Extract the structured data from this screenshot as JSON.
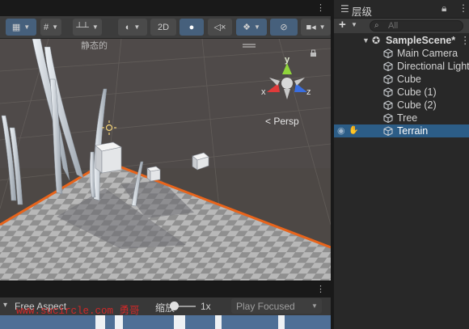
{
  "scene_toolbar": {
    "mode_2d": "2D"
  },
  "scene_view": {
    "overlay_label": "静态的",
    "gizmo": {
      "y": "y",
      "x": "x",
      "z": "z"
    },
    "projection": "< Persp"
  },
  "game_toolbar": {
    "aspect": "Free Aspect",
    "scale_label": "缩放",
    "scale_value": "1x",
    "play_mode": "Play Focused"
  },
  "hierarchy": {
    "tab_title": "层级",
    "search_placeholder": "All",
    "scene_name": "SampleScene*",
    "items": [
      {
        "label": "Main Camera"
      },
      {
        "label": "Directional Light"
      },
      {
        "label": "Cube"
      },
      {
        "label": "Cube (1)"
      },
      {
        "label": "Cube (2)"
      },
      {
        "label": "Tree"
      },
      {
        "label": "Terrain",
        "selected": true
      }
    ]
  },
  "watermark": "www.sucircle.com 勇哥",
  "colors": {
    "selection": "#2c5d87",
    "selection_outline": "#e8641b",
    "toolbar_active": "#46607c",
    "axis_x": "#e03a3a",
    "axis_y": "#8fd43a",
    "axis_z": "#3a6ee0"
  }
}
